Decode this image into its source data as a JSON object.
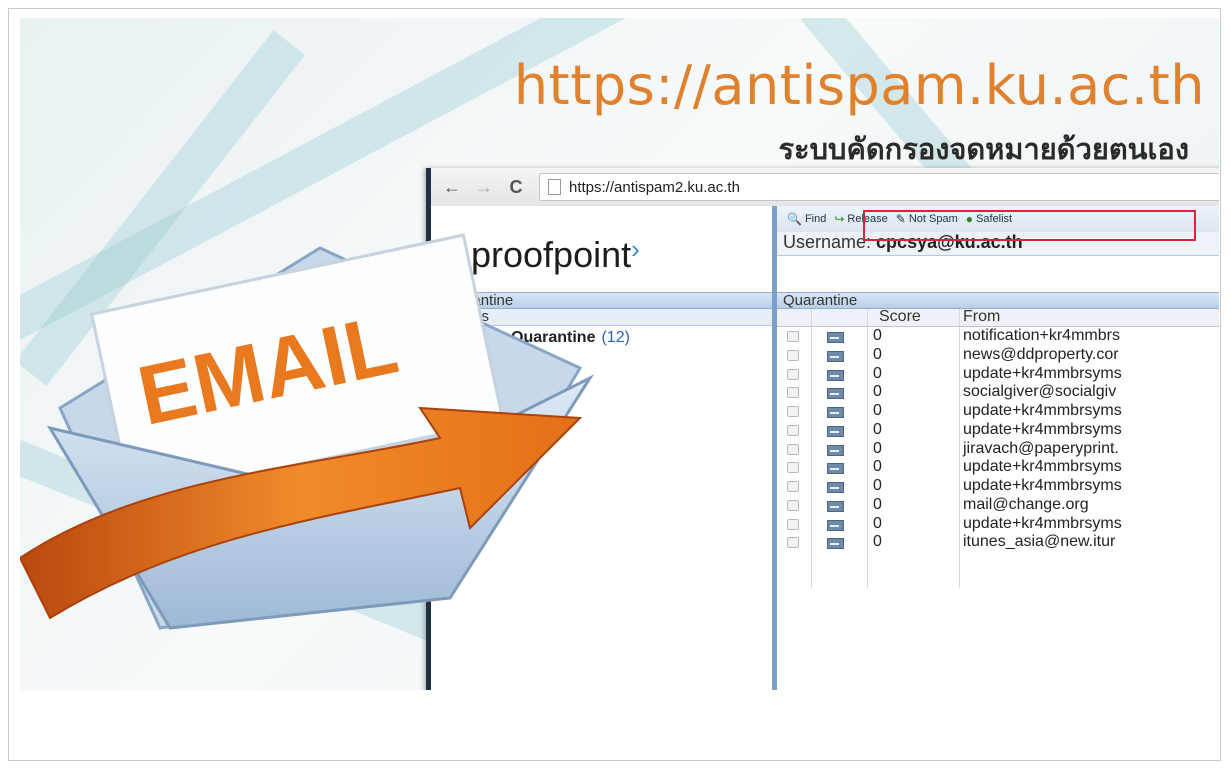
{
  "slide": {
    "url_title": "https://antispam.ku.ac.th",
    "thai_title": "ระบบคัดกรองจดหมายด้วยตนเอง",
    "envelope_text": "EMAIL"
  },
  "browser": {
    "url_host": "https://antispam2.ku.ac.th",
    "back_icon": "←",
    "forward_icon": "→",
    "reload_icon": "C"
  },
  "left_pane": {
    "logo": "proofpoint",
    "header": "Quarantine",
    "subheader": "Folders",
    "folder_label": "Quarantine",
    "folder_count": "(12)"
  },
  "toolbar": {
    "find_label": "Find",
    "release_label": "Release",
    "not_spam_label": "Not Spam",
    "safelist_label": "Safelist"
  },
  "username": {
    "label": "Username:",
    "value": "cpcsya@ku.ac.th"
  },
  "quarantine": {
    "header": "Quarantine",
    "columns": {
      "score": "Score",
      "from": "From"
    },
    "rows": [
      {
        "score": "0",
        "from": "notification+kr4mmbrs"
      },
      {
        "score": "0",
        "from": "news@ddproperty.cor"
      },
      {
        "score": "0",
        "from": "update+kr4mmbrsyms"
      },
      {
        "score": "0",
        "from": "socialgiver@socialgiv"
      },
      {
        "score": "0",
        "from": "update+kr4mmbrsyms"
      },
      {
        "score": "0",
        "from": "update+kr4mmbrsyms"
      },
      {
        "score": "0",
        "from": "jiravach@paperyprint."
      },
      {
        "score": "0",
        "from": "update+kr4mmbrsyms"
      },
      {
        "score": "0",
        "from": "update+kr4mmbrsyms"
      },
      {
        "score": "0",
        "from": "mail@change.org"
      },
      {
        "score": "0",
        "from": "update+kr4mmbrsyms"
      },
      {
        "score": "0",
        "from": "itunes_asia@new.itur"
      }
    ]
  },
  "colors": {
    "title_orange": "#e0812e",
    "highlight_red": "#d9253a",
    "pane_blue": "#7aa0c8",
    "envelope_orange": "#e8791f"
  }
}
